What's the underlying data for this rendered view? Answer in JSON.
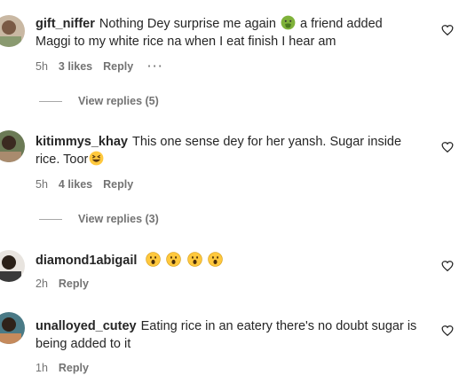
{
  "comments": [
    {
      "username": "gift_niffer",
      "text_before": "Nothing Dey surprise me again",
      "emoji": "face-with-open-mouth-vomiting",
      "text_after": "a friend added Maggi to my white rice na when I eat finish I hear am",
      "time": "5h",
      "likes": "3 likes",
      "reply_label": "Reply",
      "more": "···",
      "view_replies": "View replies (5)"
    },
    {
      "username": "kitimmys_khay",
      "text_before": "This one sense dey for her yansh. Sugar inside rice. Toor",
      "emoji": "grinning-squinting-face",
      "time": "5h",
      "likes": "4 likes",
      "reply_label": "Reply",
      "view_replies": "View replies (3)"
    },
    {
      "username": "diamond1abigail",
      "emojis": [
        "face-with-open-mouth",
        "face-with-open-mouth",
        "face-with-open-mouth",
        "face-with-open-mouth"
      ],
      "time": "2h",
      "reply_label": "Reply"
    },
    {
      "username": "unalloyed_cutey",
      "text_before": "Eating rice in an eatery there's no doubt sugar is being added to it",
      "time": "1h",
      "reply_label": "Reply"
    }
  ],
  "icons": {
    "like": "heart-outline-icon"
  },
  "colors": {
    "text": "#262626",
    "secondary": "#737373",
    "emoji_yellow": "#FFC83D"
  }
}
